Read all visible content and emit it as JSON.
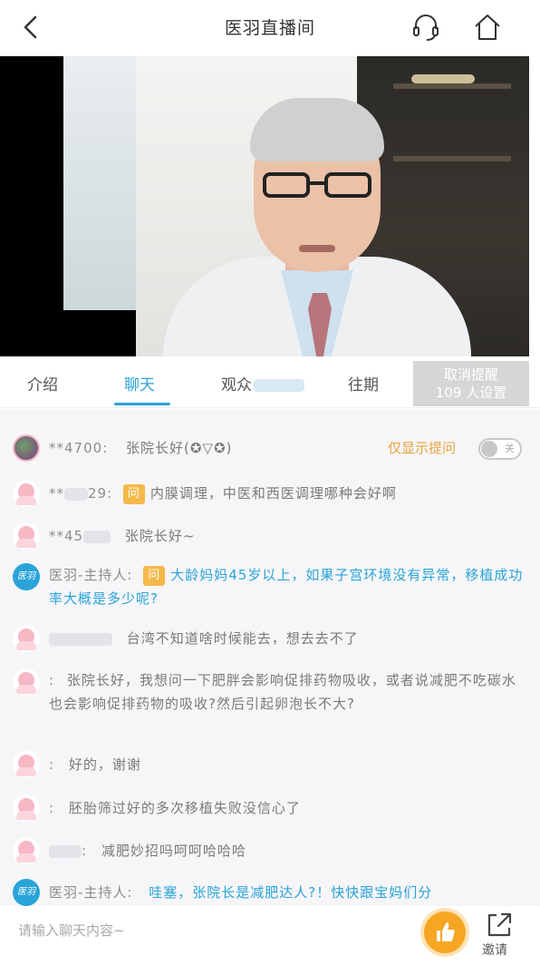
{
  "header": {
    "title": "医羽直播间",
    "back_icon": "chevron-left-icon",
    "service_icon": "headset-icon",
    "home_icon": "home-icon"
  },
  "tabs": [
    {
      "label": "介绍",
      "active": false
    },
    {
      "label": "聊天",
      "active": true
    },
    {
      "label": "观众",
      "active": false
    },
    {
      "label": "往期",
      "active": false
    }
  ],
  "reminder": {
    "line1": "取消提醒",
    "line2": "109 人设置"
  },
  "filter": {
    "label": "仅显示提问",
    "toggle_label": "关",
    "enabled": false
  },
  "messages": [
    {
      "name": "**4700:",
      "text": "张院长好(✪▽✪)",
      "avatar": "user-photo",
      "question": false
    },
    {
      "name": "**",
      "name_suffix": "29:",
      "text": "内膜调理，中医和西医调理哪种会好啊",
      "avatar": "pink",
      "question": true
    },
    {
      "name": "**45",
      "text": "张院长好~",
      "avatar": "pink",
      "question": false
    },
    {
      "name": "医羽-主持人:",
      "text": "大龄妈妈45岁以上，如果子宫环境没有异常，移植成功率大概是多少呢?",
      "avatar": "host",
      "question": true
    },
    {
      "name": "",
      "text": "台湾不知道啥时候能去，想去去不了",
      "avatar": "pink",
      "question": false
    },
    {
      "name": ":",
      "text": "张院长好，我想问一下肥胖会影响促排药物吸收，或者说减肥不吃碳水也会影响促排药物的吸收?然后引起卵泡长不大?",
      "avatar": "pink",
      "question": false
    },
    {
      "name": ":",
      "text": "好的，谢谢",
      "avatar": "pink",
      "question": false
    },
    {
      "name": ":",
      "text": "胚胎筛过好的多次移植失败没信心了",
      "avatar": "pink",
      "question": false
    },
    {
      "name": ":",
      "text": "减肥妙招吗呵呵哈哈哈",
      "avatar": "pink",
      "question": false
    },
    {
      "name": "医羽-主持人:",
      "text": "哇塞，张院长是减肥达人?！快快跟宝妈们分",
      "avatar": "host",
      "question": false
    }
  ],
  "question_badge": "问",
  "host_badge": "医羽",
  "input": {
    "placeholder": "请输入聊天内容~"
  },
  "invite": {
    "label": "邀请"
  },
  "colors": {
    "accent": "#2aa3d9",
    "question": "#f5b94a",
    "like": "#f6a623"
  }
}
